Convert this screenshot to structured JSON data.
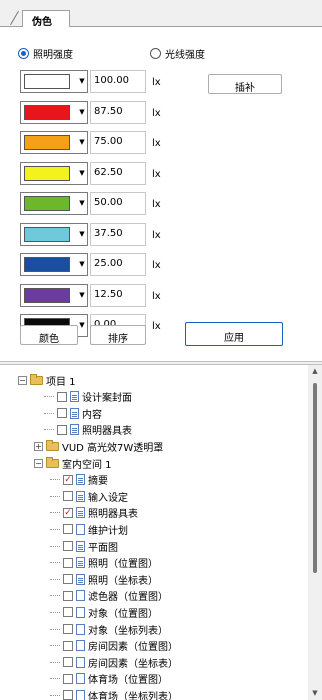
{
  "tab": {
    "label": "伪色"
  },
  "mode": {
    "illuminance_label": "照明强度",
    "luminous_label": "光线强度",
    "selected": "illuminance"
  },
  "unit": "lx",
  "rows": [
    {
      "color": "#ffffff",
      "value": "100.00"
    },
    {
      "color": "#e8161b",
      "value": "87.50"
    },
    {
      "color": "#f6a01a",
      "value": "75.00"
    },
    {
      "color": "#f2f21c",
      "value": "62.50"
    },
    {
      "color": "#6cb82a",
      "value": "50.00"
    },
    {
      "color": "#6fc9db",
      "value": "37.50"
    },
    {
      "color": "#1b4ea3",
      "value": "25.00"
    },
    {
      "color": "#6a3c9e",
      "value": "12.50"
    },
    {
      "color": "#0a0a0a",
      "value": "0.00"
    }
  ],
  "buttons": {
    "interpolate": "插补",
    "color": "颜色",
    "sort": "排序",
    "apply": "应用"
  },
  "tree": [
    {
      "label": "项目 1",
      "type": "folder",
      "expander": "−"
    },
    {
      "label": "设计案封面",
      "type": "doc",
      "checked": false
    },
    {
      "label": "内容",
      "type": "doc",
      "checked": false
    },
    {
      "label": "照明器具表",
      "type": "doc",
      "checked": false
    },
    {
      "label": "VUD 高光效7W透明罩",
      "type": "folder",
      "expander": "+"
    },
    {
      "label": "室内空间 1",
      "type": "folder",
      "expander": "−"
    },
    {
      "label": "摘要",
      "type": "doc",
      "checked": true
    },
    {
      "label": "输入设定",
      "type": "doc",
      "checked": false
    },
    {
      "label": "照明器具表",
      "type": "doc",
      "checked": true
    },
    {
      "label": "维护计划",
      "type": "plain",
      "checked": false
    },
    {
      "label": "平面图",
      "type": "doc",
      "checked": false
    },
    {
      "label": "照明（位置图）",
      "type": "doc",
      "checked": false
    },
    {
      "label": "照明（坐标表）",
      "type": "doc",
      "checked": false
    },
    {
      "label": "滤色器（位置图）",
      "type": "plain",
      "checked": false
    },
    {
      "label": "对象（位置图）",
      "type": "plain",
      "checked": false
    },
    {
      "label": "对象（坐标列表）",
      "type": "plain",
      "checked": false
    },
    {
      "label": "房间因素（位置图）",
      "type": "plain",
      "checked": false
    },
    {
      "label": "房间因素（坐标表）",
      "type": "plain",
      "checked": false
    },
    {
      "label": "体育场（位置图）",
      "type": "plain",
      "checked": false
    },
    {
      "label": "体育场（坐标列表）",
      "type": "plain",
      "checked": false
    }
  ]
}
